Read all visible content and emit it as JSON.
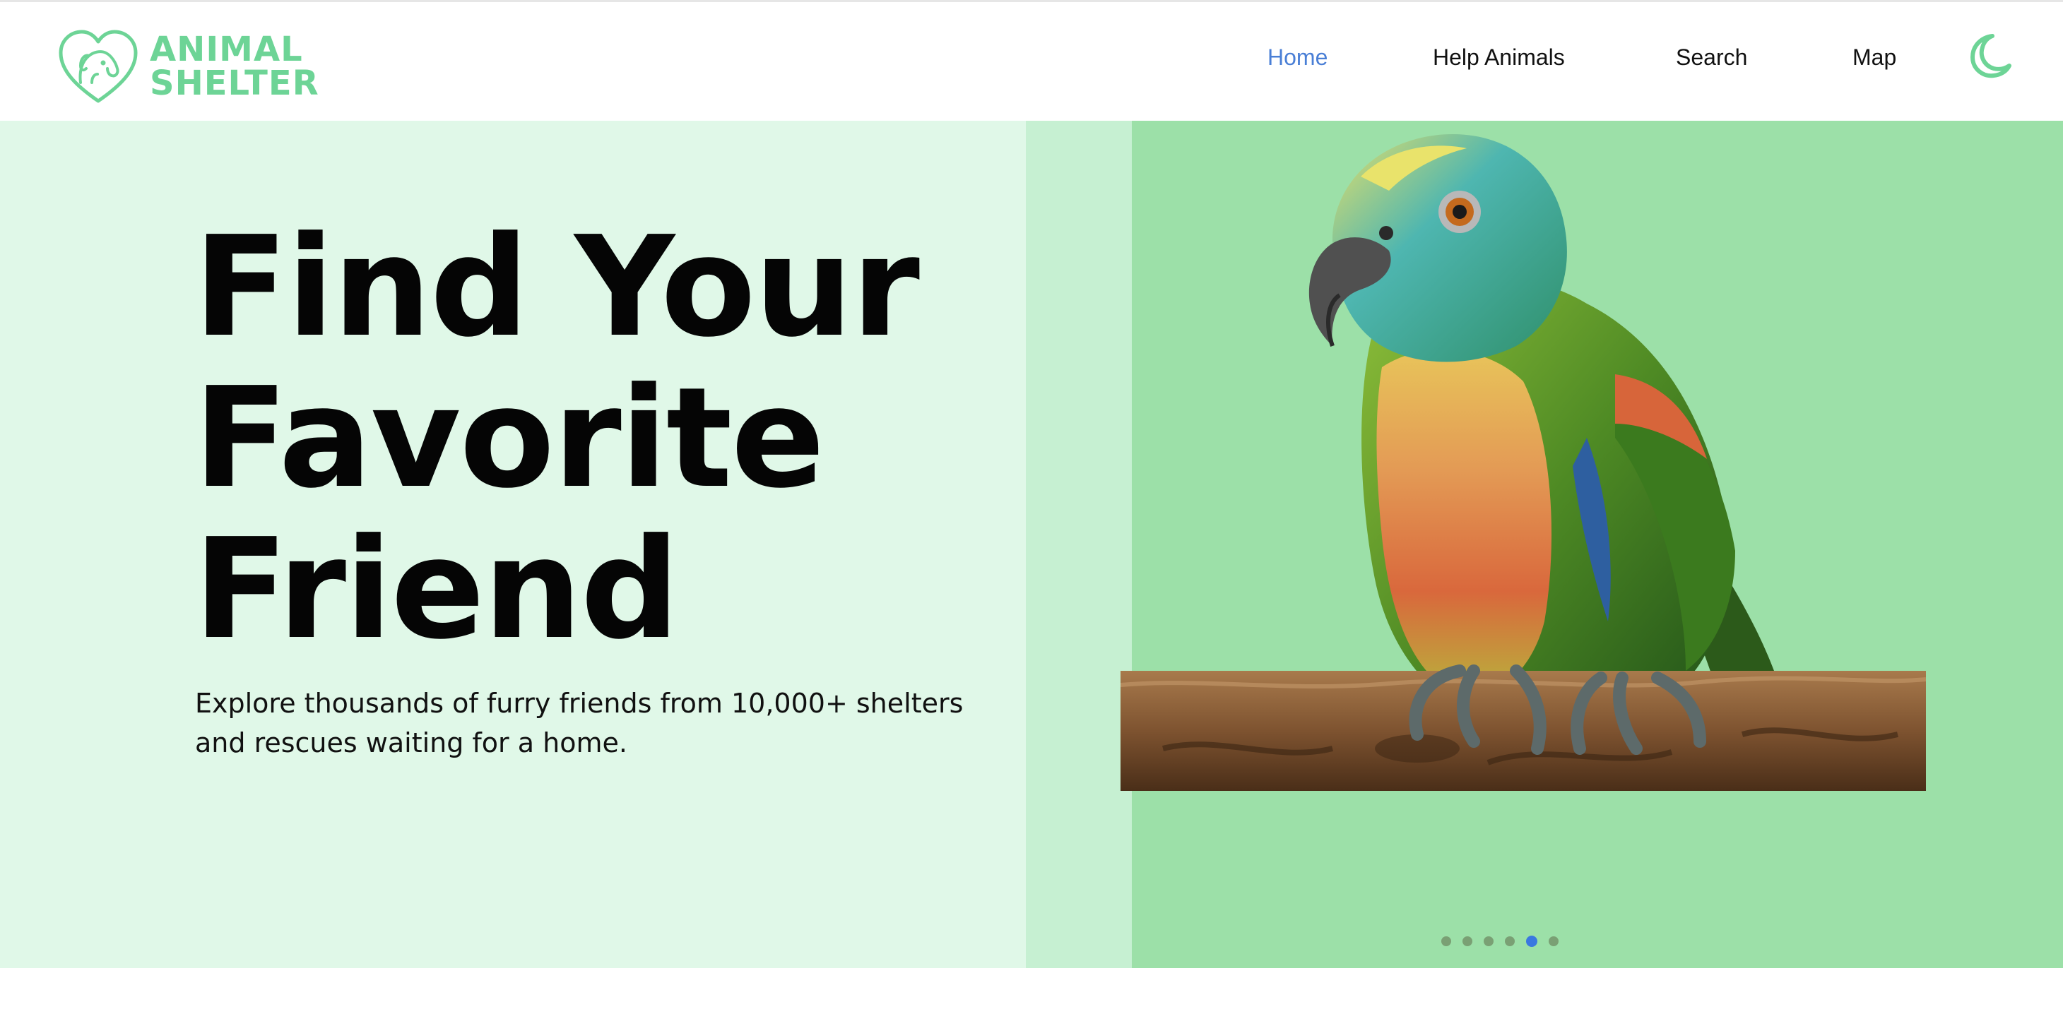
{
  "app": {
    "logo": {
      "line1": "ANIMAL",
      "line2": "SHELTER",
      "icon": "heart-dog-icon"
    }
  },
  "nav": {
    "items": [
      {
        "label": "Home",
        "active": true
      },
      {
        "label": "Help Animals",
        "active": false
      },
      {
        "label": "Search",
        "active": false
      },
      {
        "label": "Map",
        "active": false
      }
    ],
    "theme_toggle_icon": "moon-icon"
  },
  "hero": {
    "headline_line1": "Find Your",
    "headline_line2": "Favorite",
    "headline_line3": "Friend",
    "subtext_line1": "Explore thousands of furry friends from 10,000+ shelters",
    "subtext_line2": "and rescues waiting for a home.",
    "image": "parrot-on-branch",
    "carousel": {
      "count": 6,
      "active_index": 4
    }
  },
  "colors": {
    "brand_green": "#6dd496",
    "nav_active": "#4a7fd6",
    "hero_left_bg": "#e0f8e8",
    "hero_right_bg": "#9ce0a8",
    "dot_active": "#3a78e0"
  }
}
